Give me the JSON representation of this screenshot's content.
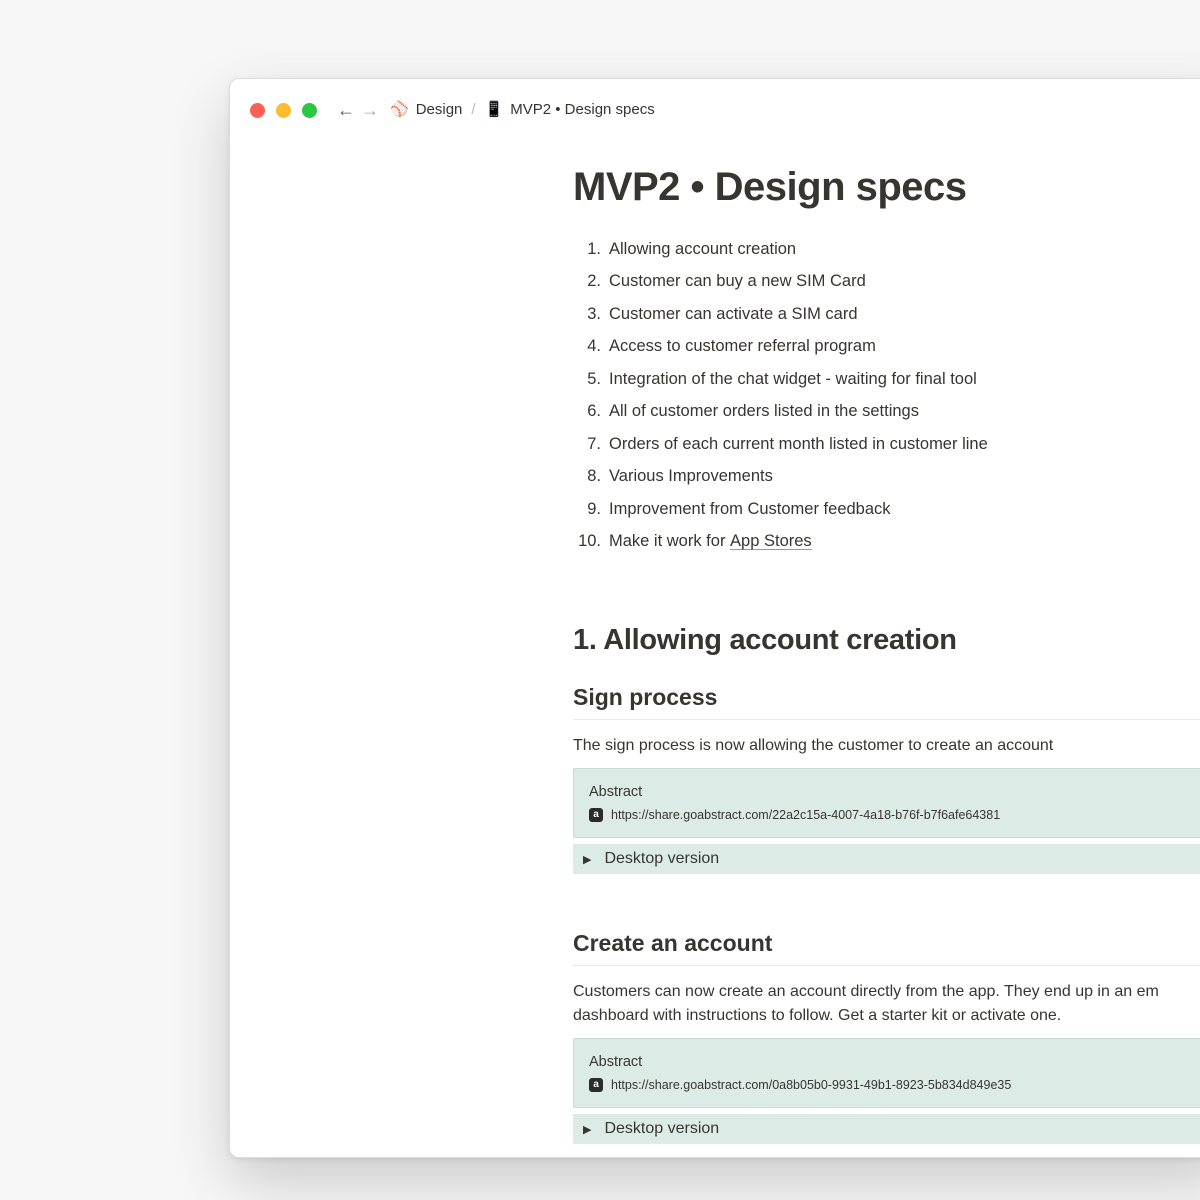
{
  "window": {
    "breadcrumb": [
      {
        "icon": "⚾",
        "label": "Design"
      },
      {
        "icon": "📱",
        "label": "MVP2 • Design specs"
      }
    ],
    "nav": {
      "back_icon": "←",
      "forward_icon": "→"
    }
  },
  "page": {
    "title": "MVP2 • Design specs",
    "toc": [
      {
        "num": "1.",
        "text": "Allowing account creation"
      },
      {
        "num": "2.",
        "text": "Customer can buy a new SIM Card"
      },
      {
        "num": "3.",
        "text": "Customer can activate a SIM card"
      },
      {
        "num": "4.",
        "text": "Access to customer referral program"
      },
      {
        "num": "5.",
        "text": "Integration of the chat widget - waiting for final tool"
      },
      {
        "num": "6.",
        "text": "All of customer orders listed in the settings"
      },
      {
        "num": "7.",
        "text": "Orders of each current month listed in customer line"
      },
      {
        "num": "8.",
        "text": "Various Improvements"
      },
      {
        "num": "9.",
        "text": "Improvement from Customer feedback"
      },
      {
        "num": "10.",
        "text_prefix": "Make it work for ",
        "link": "App Stores"
      }
    ],
    "section1": {
      "heading": "1. Allowing account creation",
      "sign": {
        "heading": "Sign process",
        "text": "The sign process is now allowing the customer to create an account",
        "embed_title": "Abstract",
        "embed_url": "https://share.goabstract.com/22a2c15a-4007-4a18-b76f-b7f6afe64381",
        "toggle": "Desktop version"
      },
      "create": {
        "heading": "Create an account",
        "text_line1": "Customers can now create an account directly from the app. They end up in an em",
        "text_line2": "dashboard with instructions to follow. Get a starter kit or activate one.",
        "embed_title": "Abstract",
        "embed_url": "https://share.goabstract.com/0a8b05b0-9931-49b1-8923-5b834d849e35",
        "toggle": "Desktop version"
      }
    }
  },
  "colors": {
    "red": "#ff5f57",
    "yellow": "#febc2e",
    "green": "#28c840",
    "callout_bg": "#ddebe7"
  }
}
